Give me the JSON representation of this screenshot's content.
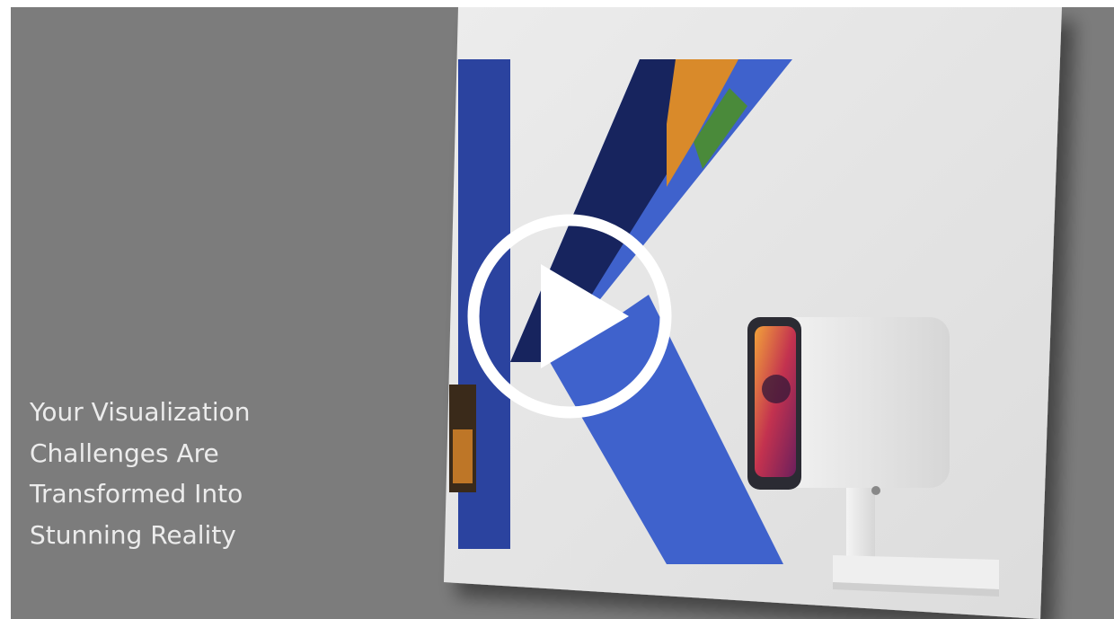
{
  "video": {
    "tagline_lines": [
      "Your Visualization",
      "Challenges Are",
      "Transformed Into",
      "Stunning Reality"
    ],
    "play_icon": "play-icon"
  },
  "colors": {
    "background": "#7c7c7c",
    "card": "#e6e6e6",
    "letter_blue": "#3f62cc",
    "tagline_text": "#ececec",
    "play_button": "#ffffff"
  }
}
